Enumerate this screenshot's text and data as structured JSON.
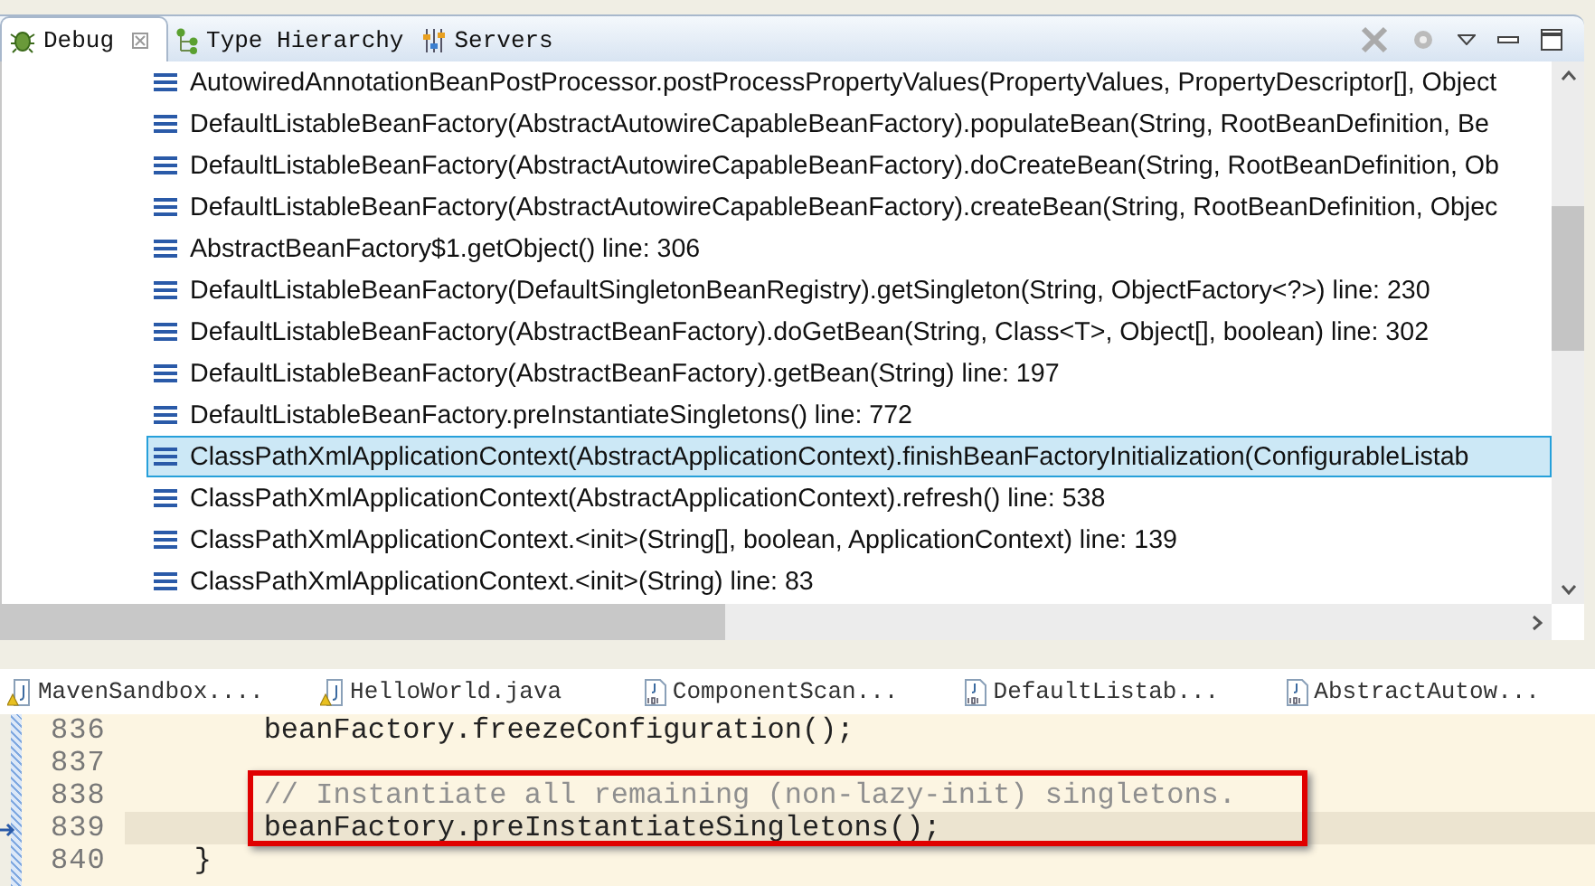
{
  "view_tabs": [
    {
      "label": "Debug",
      "selected": true,
      "closable": true
    },
    {
      "label": "Type Hierarchy",
      "selected": false,
      "closable": false
    },
    {
      "label": "Servers",
      "selected": false,
      "closable": false
    }
  ],
  "stack_frames": [
    {
      "text": "AutowiredAnnotationBeanPostProcessor.postProcessPropertyValues(PropertyValues, PropertyDescriptor[], Object",
      "selected": false
    },
    {
      "text": "DefaultListableBeanFactory(AbstractAutowireCapableBeanFactory).populateBean(String, RootBeanDefinition, Be",
      "selected": false
    },
    {
      "text": "DefaultListableBeanFactory(AbstractAutowireCapableBeanFactory).doCreateBean(String, RootBeanDefinition, Ob",
      "selected": false
    },
    {
      "text": "DefaultListableBeanFactory(AbstractAutowireCapableBeanFactory).createBean(String, RootBeanDefinition, Objec",
      "selected": false
    },
    {
      "text": "AbstractBeanFactory$1.getObject() line: 306",
      "selected": false
    },
    {
      "text": "DefaultListableBeanFactory(DefaultSingletonBeanRegistry).getSingleton(String, ObjectFactory<?>) line: 230",
      "selected": false
    },
    {
      "text": "DefaultListableBeanFactory(AbstractBeanFactory).doGetBean(String, Class<T>, Object[], boolean) line: 302",
      "selected": false
    },
    {
      "text": "DefaultListableBeanFactory(AbstractBeanFactory).getBean(String) line: 197",
      "selected": false
    },
    {
      "text": "DefaultListableBeanFactory.preInstantiateSingletons() line: 772",
      "selected": false
    },
    {
      "text": "ClassPathXmlApplicationContext(AbstractApplicationContext).finishBeanFactoryInitialization(ConfigurableListab",
      "selected": true
    },
    {
      "text": "ClassPathXmlApplicationContext(AbstractApplicationContext).refresh() line: 538",
      "selected": false
    },
    {
      "text": "ClassPathXmlApplicationContext.<init>(String[], boolean, ApplicationContext) line: 139",
      "selected": false
    },
    {
      "text": "ClassPathXmlApplicationContext.<init>(String) line: 83",
      "selected": false
    }
  ],
  "editor_tabs": [
    {
      "label": "MavenSandbox....",
      "kind": "source"
    },
    {
      "label": "HelloWorld.java",
      "kind": "source"
    },
    {
      "label": "ComponentScan...",
      "kind": "class"
    },
    {
      "label": "DefaultListab...",
      "kind": "class"
    },
    {
      "label": "AbstractAutow...",
      "kind": "class"
    }
  ],
  "code_lines": [
    {
      "number": "836",
      "text": "        beanFactory.freezeConfiguration();",
      "kind": "code",
      "current": false
    },
    {
      "number": "837",
      "current": false
    },
    {
      "number": "838",
      "text": "        // Instantiate all remaining (non-lazy-init) singletons.",
      "kind": "comment",
      "current": false
    },
    {
      "number": "839",
      "text": "        beanFactory.preInstantiateSingletons();",
      "kind": "code",
      "current": true
    },
    {
      "number": "840",
      "text": "    }",
      "kind": "code",
      "current": false
    }
  ]
}
